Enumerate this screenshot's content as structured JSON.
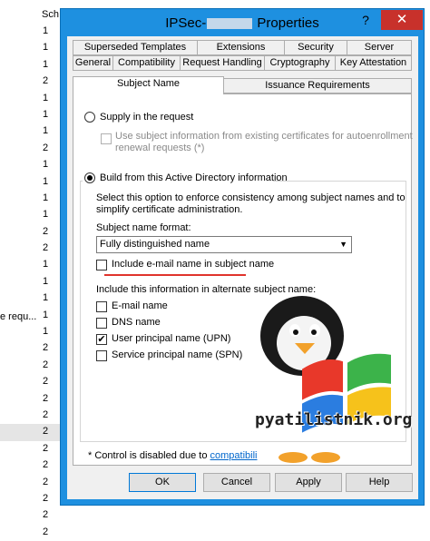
{
  "background": {
    "column_header": "Sch",
    "row_values": [
      "1",
      "1",
      "1",
      "2",
      "1",
      "1",
      "1",
      "2",
      "1",
      "1",
      "1",
      "1",
      "2",
      "2",
      "1",
      "1",
      "1",
      "1",
      "1",
      "2",
      "2",
      "2",
      "2",
      "2",
      "2",
      "2",
      "2",
      "2",
      "2",
      "2",
      "2"
    ],
    "left_text": "e requ..."
  },
  "dialog": {
    "title_prefix": "IPSec-",
    "title_suffix": " Properties",
    "help_icon": "?",
    "close_icon": "✕"
  },
  "tabs": {
    "row1": [
      "Superseded Templates",
      "Extensions",
      "Security",
      "Server"
    ],
    "row2": [
      "General",
      "Compatibility",
      "Request Handling",
      "Cryptography",
      "Key Attestation"
    ],
    "row3": [
      "Subject Name",
      "Issuance Requirements"
    ]
  },
  "subject_name": {
    "supply_label": "Supply in the request",
    "use_existing_label_line1": "Use subject information from existing certificates for autoenrollment",
    "use_existing_label_line2": "renewal requests (*)",
    "build_label": "Build from this Active Directory information",
    "build_desc_line1": "Select this option to enforce consistency among subject names and to",
    "build_desc_line2": "simplify certificate administration.",
    "format_label": "Subject name format:",
    "format_value": "Fully distinguished name",
    "include_email_label": "Include e-mail name in subject name",
    "alt_label": "Include this information in alternate subject name:",
    "alt_options": [
      {
        "label": "E-mail name",
        "checked": false
      },
      {
        "label": "DNS name",
        "checked": false
      },
      {
        "label": "User principal name (UPN)",
        "checked": true
      },
      {
        "label": "Service principal name (SPN)",
        "checked": false
      }
    ],
    "footnote_prefix": "* Control is disabled due to ",
    "footnote_link": "compatibili"
  },
  "buttons": {
    "ok": "OK",
    "cancel": "Cancel",
    "apply": "Apply",
    "help": "Help"
  },
  "watermark": {
    "text": "pyatilistnik.org"
  },
  "colors": {
    "title_bar": "#1e90e0",
    "close_button": "#c8312b",
    "highlight_line": "#e0332c",
    "link": "#0066cc"
  }
}
